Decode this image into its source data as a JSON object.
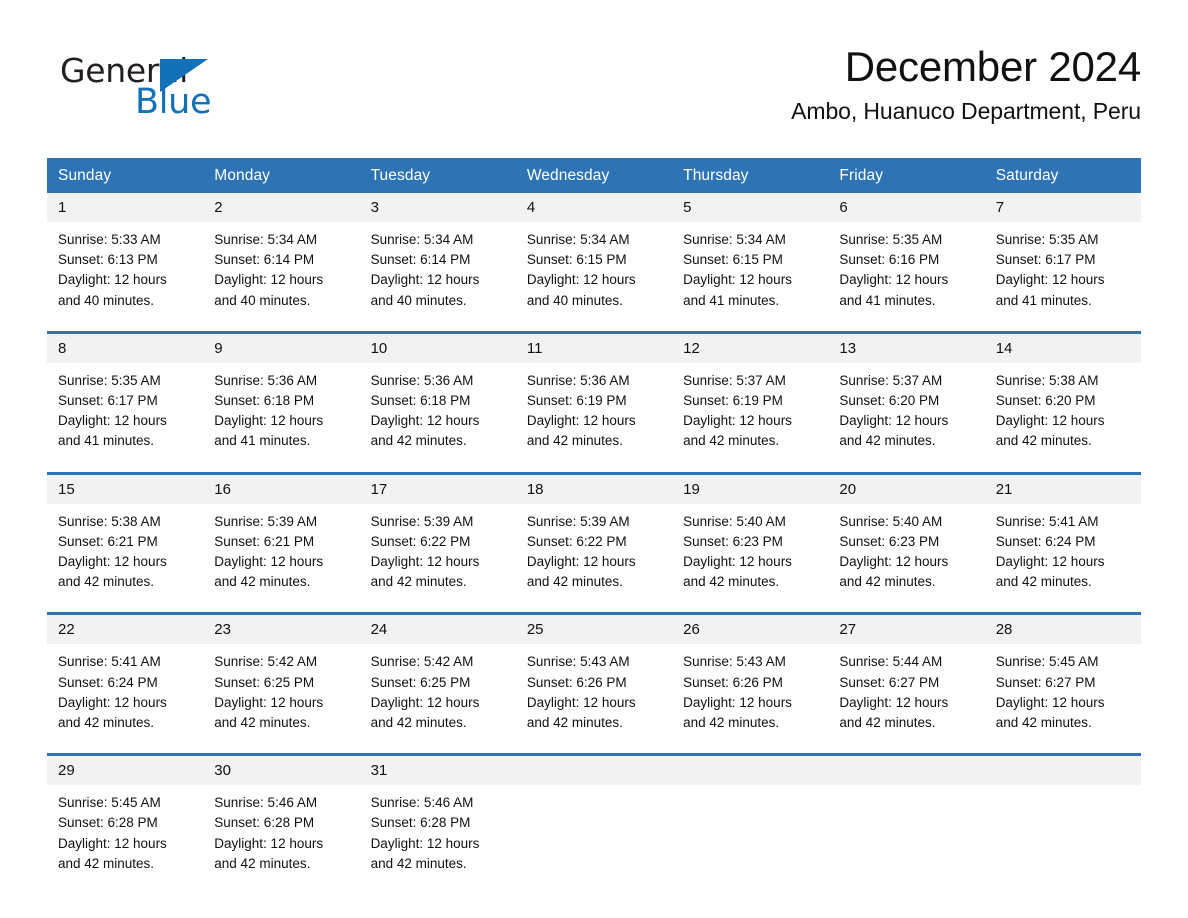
{
  "brand": {
    "name_part1": "General",
    "name_part2": "Blue",
    "accent_color": "#1271b8"
  },
  "header": {
    "month_title": "December 2024",
    "location": "Ambo, Huanuco Department, Peru"
  },
  "theme": {
    "header_blue": "#2e74b5",
    "daynum_gray": "#f2f2f2"
  },
  "calendar": {
    "weekday_headers": [
      "Sunday",
      "Monday",
      "Tuesday",
      "Wednesday",
      "Thursday",
      "Friday",
      "Saturday"
    ],
    "weeks": [
      [
        {
          "day": "1",
          "sunrise": "Sunrise: 5:33 AM",
          "sunset": "Sunset: 6:13 PM",
          "daylight_line1": "Daylight: 12 hours",
          "daylight_line2": "and 40 minutes."
        },
        {
          "day": "2",
          "sunrise": "Sunrise: 5:34 AM",
          "sunset": "Sunset: 6:14 PM",
          "daylight_line1": "Daylight: 12 hours",
          "daylight_line2": "and 40 minutes."
        },
        {
          "day": "3",
          "sunrise": "Sunrise: 5:34 AM",
          "sunset": "Sunset: 6:14 PM",
          "daylight_line1": "Daylight: 12 hours",
          "daylight_line2": "and 40 minutes."
        },
        {
          "day": "4",
          "sunrise": "Sunrise: 5:34 AM",
          "sunset": "Sunset: 6:15 PM",
          "daylight_line1": "Daylight: 12 hours",
          "daylight_line2": "and 40 minutes."
        },
        {
          "day": "5",
          "sunrise": "Sunrise: 5:34 AM",
          "sunset": "Sunset: 6:15 PM",
          "daylight_line1": "Daylight: 12 hours",
          "daylight_line2": "and 41 minutes."
        },
        {
          "day": "6",
          "sunrise": "Sunrise: 5:35 AM",
          "sunset": "Sunset: 6:16 PM",
          "daylight_line1": "Daylight: 12 hours",
          "daylight_line2": "and 41 minutes."
        },
        {
          "day": "7",
          "sunrise": "Sunrise: 5:35 AM",
          "sunset": "Sunset: 6:17 PM",
          "daylight_line1": "Daylight: 12 hours",
          "daylight_line2": "and 41 minutes."
        }
      ],
      [
        {
          "day": "8",
          "sunrise": "Sunrise: 5:35 AM",
          "sunset": "Sunset: 6:17 PM",
          "daylight_line1": "Daylight: 12 hours",
          "daylight_line2": "and 41 minutes."
        },
        {
          "day": "9",
          "sunrise": "Sunrise: 5:36 AM",
          "sunset": "Sunset: 6:18 PM",
          "daylight_line1": "Daylight: 12 hours",
          "daylight_line2": "and 41 minutes."
        },
        {
          "day": "10",
          "sunrise": "Sunrise: 5:36 AM",
          "sunset": "Sunset: 6:18 PM",
          "daylight_line1": "Daylight: 12 hours",
          "daylight_line2": "and 42 minutes."
        },
        {
          "day": "11",
          "sunrise": "Sunrise: 5:36 AM",
          "sunset": "Sunset: 6:19 PM",
          "daylight_line1": "Daylight: 12 hours",
          "daylight_line2": "and 42 minutes."
        },
        {
          "day": "12",
          "sunrise": "Sunrise: 5:37 AM",
          "sunset": "Sunset: 6:19 PM",
          "daylight_line1": "Daylight: 12 hours",
          "daylight_line2": "and 42 minutes."
        },
        {
          "day": "13",
          "sunrise": "Sunrise: 5:37 AM",
          "sunset": "Sunset: 6:20 PM",
          "daylight_line1": "Daylight: 12 hours",
          "daylight_line2": "and 42 minutes."
        },
        {
          "day": "14",
          "sunrise": "Sunrise: 5:38 AM",
          "sunset": "Sunset: 6:20 PM",
          "daylight_line1": "Daylight: 12 hours",
          "daylight_line2": "and 42 minutes."
        }
      ],
      [
        {
          "day": "15",
          "sunrise": "Sunrise: 5:38 AM",
          "sunset": "Sunset: 6:21 PM",
          "daylight_line1": "Daylight: 12 hours",
          "daylight_line2": "and 42 minutes."
        },
        {
          "day": "16",
          "sunrise": "Sunrise: 5:39 AM",
          "sunset": "Sunset: 6:21 PM",
          "daylight_line1": "Daylight: 12 hours",
          "daylight_line2": "and 42 minutes."
        },
        {
          "day": "17",
          "sunrise": "Sunrise: 5:39 AM",
          "sunset": "Sunset: 6:22 PM",
          "daylight_line1": "Daylight: 12 hours",
          "daylight_line2": "and 42 minutes."
        },
        {
          "day": "18",
          "sunrise": "Sunrise: 5:39 AM",
          "sunset": "Sunset: 6:22 PM",
          "daylight_line1": "Daylight: 12 hours",
          "daylight_line2": "and 42 minutes."
        },
        {
          "day": "19",
          "sunrise": "Sunrise: 5:40 AM",
          "sunset": "Sunset: 6:23 PM",
          "daylight_line1": "Daylight: 12 hours",
          "daylight_line2": "and 42 minutes."
        },
        {
          "day": "20",
          "sunrise": "Sunrise: 5:40 AM",
          "sunset": "Sunset: 6:23 PM",
          "daylight_line1": "Daylight: 12 hours",
          "daylight_line2": "and 42 minutes."
        },
        {
          "day": "21",
          "sunrise": "Sunrise: 5:41 AM",
          "sunset": "Sunset: 6:24 PM",
          "daylight_line1": "Daylight: 12 hours",
          "daylight_line2": "and 42 minutes."
        }
      ],
      [
        {
          "day": "22",
          "sunrise": "Sunrise: 5:41 AM",
          "sunset": "Sunset: 6:24 PM",
          "daylight_line1": "Daylight: 12 hours",
          "daylight_line2": "and 42 minutes."
        },
        {
          "day": "23",
          "sunrise": "Sunrise: 5:42 AM",
          "sunset": "Sunset: 6:25 PM",
          "daylight_line1": "Daylight: 12 hours",
          "daylight_line2": "and 42 minutes."
        },
        {
          "day": "24",
          "sunrise": "Sunrise: 5:42 AM",
          "sunset": "Sunset: 6:25 PM",
          "daylight_line1": "Daylight: 12 hours",
          "daylight_line2": "and 42 minutes."
        },
        {
          "day": "25",
          "sunrise": "Sunrise: 5:43 AM",
          "sunset": "Sunset: 6:26 PM",
          "daylight_line1": "Daylight: 12 hours",
          "daylight_line2": "and 42 minutes."
        },
        {
          "day": "26",
          "sunrise": "Sunrise: 5:43 AM",
          "sunset": "Sunset: 6:26 PM",
          "daylight_line1": "Daylight: 12 hours",
          "daylight_line2": "and 42 minutes."
        },
        {
          "day": "27",
          "sunrise": "Sunrise: 5:44 AM",
          "sunset": "Sunset: 6:27 PM",
          "daylight_line1": "Daylight: 12 hours",
          "daylight_line2": "and 42 minutes."
        },
        {
          "day": "28",
          "sunrise": "Sunrise: 5:45 AM",
          "sunset": "Sunset: 6:27 PM",
          "daylight_line1": "Daylight: 12 hours",
          "daylight_line2": "and 42 minutes."
        }
      ],
      [
        {
          "day": "29",
          "sunrise": "Sunrise: 5:45 AM",
          "sunset": "Sunset: 6:28 PM",
          "daylight_line1": "Daylight: 12 hours",
          "daylight_line2": "and 42 minutes."
        },
        {
          "day": "30",
          "sunrise": "Sunrise: 5:46 AM",
          "sunset": "Sunset: 6:28 PM",
          "daylight_line1": "Daylight: 12 hours",
          "daylight_line2": "and 42 minutes."
        },
        {
          "day": "31",
          "sunrise": "Sunrise: 5:46 AM",
          "sunset": "Sunset: 6:28 PM",
          "daylight_line1": "Daylight: 12 hours",
          "daylight_line2": "and 42 minutes."
        },
        {
          "day": "",
          "sunrise": "",
          "sunset": "",
          "daylight_line1": "",
          "daylight_line2": ""
        },
        {
          "day": "",
          "sunrise": "",
          "sunset": "",
          "daylight_line1": "",
          "daylight_line2": ""
        },
        {
          "day": "",
          "sunrise": "",
          "sunset": "",
          "daylight_line1": "",
          "daylight_line2": ""
        },
        {
          "day": "",
          "sunrise": "",
          "sunset": "",
          "daylight_line1": "",
          "daylight_line2": ""
        }
      ]
    ]
  }
}
